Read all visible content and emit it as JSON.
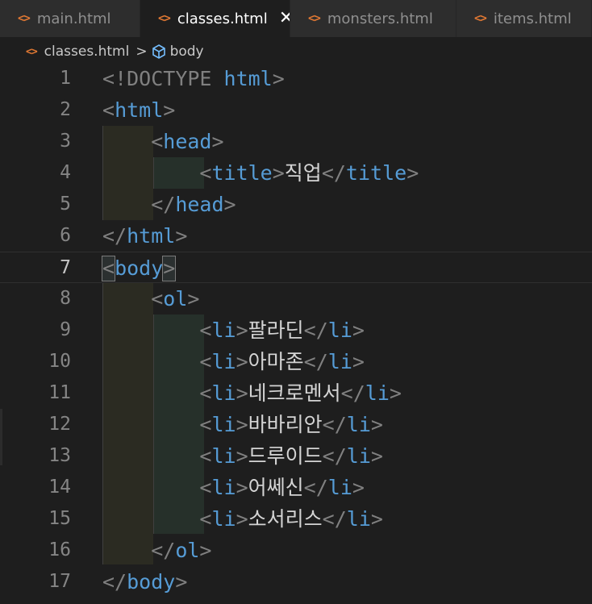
{
  "tabs": [
    {
      "label": "main.html",
      "icon": "html-file-icon",
      "active": false
    },
    {
      "label": "classes.html",
      "icon": "html-file-icon",
      "active": true
    },
    {
      "label": "monsters.html",
      "icon": "html-file-icon",
      "active": false
    },
    {
      "label": "items.html",
      "icon": "html-file-icon",
      "active": false
    }
  ],
  "tab_icon_glyph": "<>",
  "close_glyph": "✕",
  "breadcrumb": {
    "file": "classes.html",
    "separator": ">",
    "symbol": "body"
  },
  "lines": [
    {
      "n": "1",
      "parts": [
        [
          "pun",
          "<"
        ],
        [
          "pun",
          "!DOCTYPE "
        ],
        [
          "tg",
          "html"
        ],
        [
          "pun",
          ">"
        ]
      ]
    },
    {
      "n": "2",
      "parts": [
        [
          "pun",
          "<"
        ],
        [
          "tg",
          "html"
        ],
        [
          "pun",
          ">"
        ]
      ]
    },
    {
      "n": "3",
      "parts": [
        [
          "pun",
          "    <"
        ],
        [
          "tg",
          "head"
        ],
        [
          "pun",
          ">"
        ]
      ]
    },
    {
      "n": "4",
      "parts": [
        [
          "pun",
          "        <"
        ],
        [
          "tg",
          "title"
        ],
        [
          "pun",
          ">"
        ],
        [
          "txt",
          "직업"
        ],
        [
          "pun",
          "</"
        ],
        [
          "tg",
          "title"
        ],
        [
          "pun",
          ">"
        ]
      ]
    },
    {
      "n": "5",
      "parts": [
        [
          "pun",
          "    </"
        ],
        [
          "tg",
          "head"
        ],
        [
          "pun",
          ">"
        ]
      ]
    },
    {
      "n": "6",
      "parts": [
        [
          "pun",
          "</"
        ],
        [
          "tg",
          "html"
        ],
        [
          "pun",
          ">"
        ]
      ]
    },
    {
      "n": "7",
      "parts": [
        [
          "pun",
          "<"
        ],
        [
          "tg",
          "body"
        ],
        [
          "pun",
          ">"
        ]
      ]
    },
    {
      "n": "8",
      "parts": [
        [
          "pun",
          "    <"
        ],
        [
          "tg",
          "ol"
        ],
        [
          "pun",
          ">"
        ]
      ]
    },
    {
      "n": "9",
      "parts": [
        [
          "pun",
          "        <"
        ],
        [
          "tg",
          "li"
        ],
        [
          "pun",
          ">"
        ],
        [
          "txt",
          "팔라딘"
        ],
        [
          "pun",
          "</"
        ],
        [
          "tg",
          "li"
        ],
        [
          "pun",
          ">"
        ]
      ]
    },
    {
      "n": "10",
      "parts": [
        [
          "pun",
          "        <"
        ],
        [
          "tg",
          "li"
        ],
        [
          "pun",
          ">"
        ],
        [
          "txt",
          "아마존"
        ],
        [
          "pun",
          "</"
        ],
        [
          "tg",
          "li"
        ],
        [
          "pun",
          ">"
        ]
      ]
    },
    {
      "n": "11",
      "parts": [
        [
          "pun",
          "        <"
        ],
        [
          "tg",
          "li"
        ],
        [
          "pun",
          ">"
        ],
        [
          "txt",
          "네크로멘서"
        ],
        [
          "pun",
          "</"
        ],
        [
          "tg",
          "li"
        ],
        [
          "pun",
          ">"
        ]
      ]
    },
    {
      "n": "12",
      "parts": [
        [
          "pun",
          "        <"
        ],
        [
          "tg",
          "li"
        ],
        [
          "pun",
          ">"
        ],
        [
          "txt",
          "바바리안"
        ],
        [
          "pun",
          "</"
        ],
        [
          "tg",
          "li"
        ],
        [
          "pun",
          ">"
        ]
      ]
    },
    {
      "n": "13",
      "parts": [
        [
          "pun",
          "        <"
        ],
        [
          "tg",
          "li"
        ],
        [
          "pun",
          ">"
        ],
        [
          "txt",
          "드루이드"
        ],
        [
          "pun",
          "</"
        ],
        [
          "tg",
          "li"
        ],
        [
          "pun",
          ">"
        ]
      ]
    },
    {
      "n": "14",
      "parts": [
        [
          "pun",
          "        <"
        ],
        [
          "tg",
          "li"
        ],
        [
          "pun",
          ">"
        ],
        [
          "txt",
          "어쎄신"
        ],
        [
          "pun",
          "</"
        ],
        [
          "tg",
          "li"
        ],
        [
          "pun",
          ">"
        ]
      ]
    },
    {
      "n": "15",
      "parts": [
        [
          "pun",
          "        <"
        ],
        [
          "tg",
          "li"
        ],
        [
          "pun",
          ">"
        ],
        [
          "txt",
          "소서리스"
        ],
        [
          "pun",
          "</"
        ],
        [
          "tg",
          "li"
        ],
        [
          "pun",
          ">"
        ]
      ]
    },
    {
      "n": "16",
      "parts": [
        [
          "pun",
          "    </"
        ],
        [
          "tg",
          "ol"
        ],
        [
          "pun",
          ">"
        ]
      ]
    },
    {
      "n": "17",
      "parts": [
        [
          "pun",
          "</"
        ],
        [
          "tg",
          "body"
        ],
        [
          "pun",
          ">"
        ]
      ]
    }
  ],
  "current_line": "7",
  "colors": {
    "tag": "#569cd6",
    "bracket": "#808080",
    "text": "#d4d4d4",
    "html_icon": "#e37933",
    "background": "#1e1e1e"
  }
}
